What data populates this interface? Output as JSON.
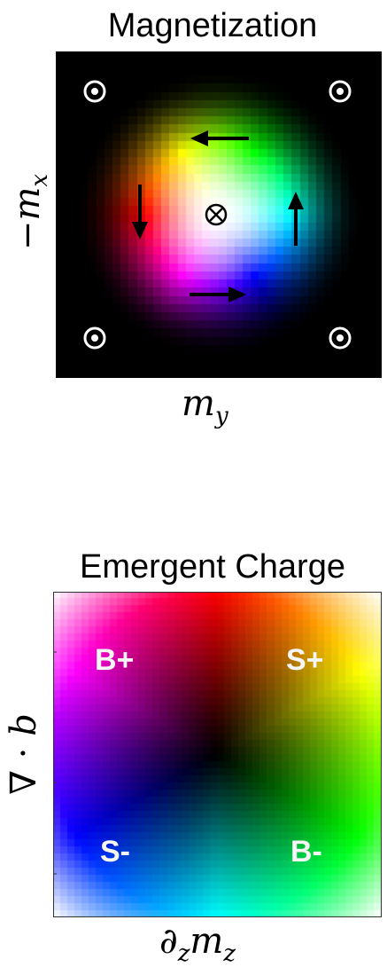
{
  "magnetization": {
    "title": "Magnetization",
    "xlabel": "m_y",
    "ylabel": "−m_x",
    "center_symbol": "⊗",
    "corner_symbol": "⊙"
  },
  "emergent_charge": {
    "title": "Emergent Charge",
    "xlabel": "∂_z m_z",
    "ylabel": "∇ · b",
    "quadrants": {
      "top_left": "B+",
      "top_right": "S+",
      "bottom_left": "S-",
      "bottom_right": "B-"
    }
  }
}
